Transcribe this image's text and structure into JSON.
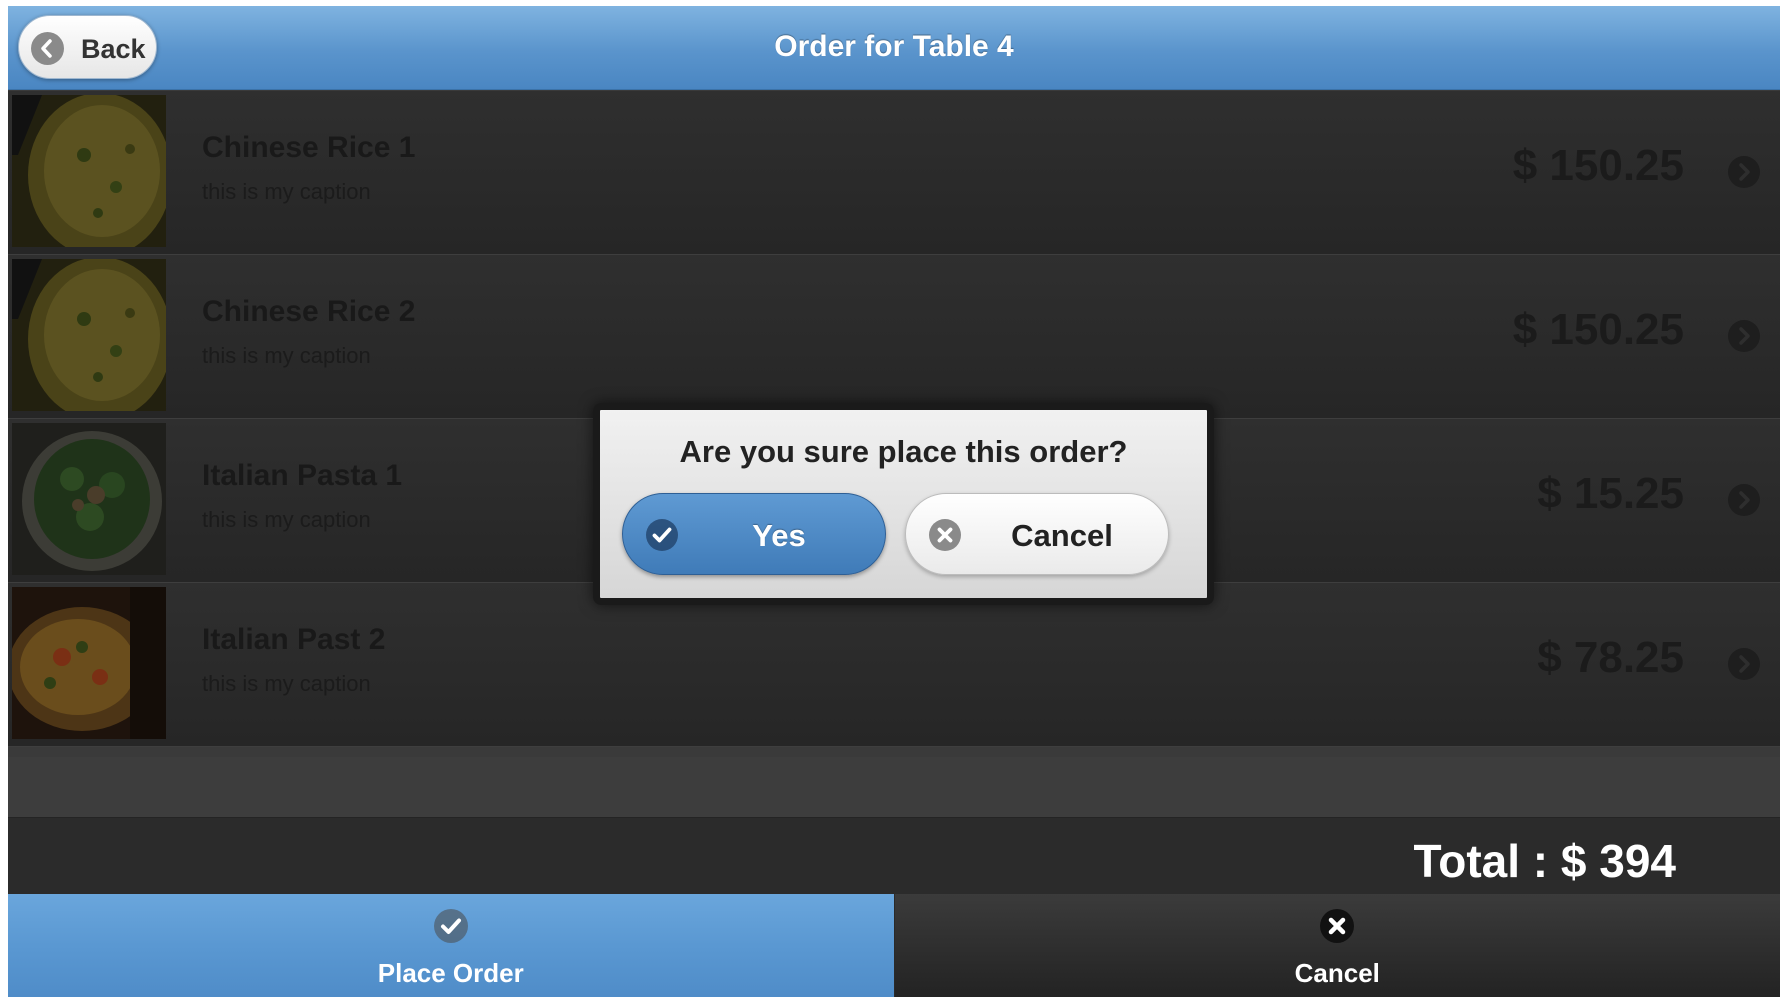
{
  "header": {
    "back_label": "Back",
    "title": "Order for Table 4"
  },
  "items": [
    {
      "name": "Chinese Rice 1",
      "caption": "this is my caption",
      "price": "$ 150.25",
      "image": "fried-rice-photo"
    },
    {
      "name": "Chinese Rice 2",
      "caption": "this is my caption",
      "price": "$ 150.25",
      "image": "fried-rice-photo"
    },
    {
      "name": "Italian Pasta 1",
      "caption": "this is my caption",
      "price": "$ 15.25",
      "image": "pasta-salad-photo"
    },
    {
      "name": "Italian Past 2",
      "caption": "this is my caption",
      "price": "$ 78.25",
      "image": "pasta-dish-photo"
    }
  ],
  "total": {
    "text": "Total : $ 394"
  },
  "footer": {
    "place_order_label": "Place Order",
    "cancel_label": "Cancel"
  },
  "dialog": {
    "question": "Are you sure place this order?",
    "yes_label": "Yes",
    "cancel_label": "Cancel"
  },
  "icons": {
    "back": "arrow-left-circle-icon",
    "list_arrow": "chevron-right-circle-icon",
    "check": "check-icon",
    "close": "close-icon"
  },
  "colors": {
    "header_blue": "#5a94cc",
    "footer_active_blue": "#5a98d2",
    "dialog_yes_blue": "#3f7bb8",
    "list_background": "#2b2b2b"
  }
}
